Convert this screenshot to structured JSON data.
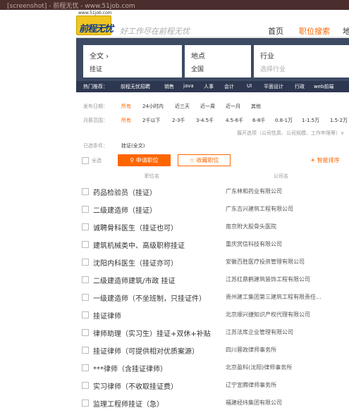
{
  "browser": {
    "tab_text": "[screenshot] - 前程无忧 - www.51job.com"
  },
  "header": {
    "logo_url": "www.51job.com",
    "logo_text": "前程无忧",
    "slogan": "好工作尽在前程无忧",
    "nav": [
      "首页",
      "职位搜索",
      "地"
    ]
  },
  "search": {
    "keyword_label": "全文 ›",
    "keyword_value": "挂证",
    "location_label": "地点",
    "location_value": "全国",
    "industry_label": "行业",
    "industry_placeholder": "选择行业"
  },
  "hot": {
    "label": "热门推荐：",
    "items": [
      "前程无忧招聘",
      "销售",
      "java",
      "人事",
      "会计",
      "UI",
      "平面设计",
      "行政",
      "web前端"
    ]
  },
  "filters": {
    "date_label": "发布日期：",
    "date_options": [
      "所有",
      "24小时内",
      "近三天",
      "近一周",
      "近一月",
      "其他"
    ],
    "salary_label": "月薪范围：",
    "salary_options": [
      "所有",
      "2千以下",
      "2-3千",
      "3-4.5千",
      "4.5-6千",
      "6-8千",
      "0.8-1万",
      "1-1.5万",
      "1.5-2万"
    ],
    "expand_text": "展开选项（公司性质、公司规模、工作年限等）∨"
  },
  "selected": {
    "label": "已选条件：",
    "value": "挂证(全文)"
  },
  "toolbar": {
    "select_all": "全选",
    "apply": "申请职位",
    "favorite": "收藏职位",
    "smart_sort": "智能排序"
  },
  "columns": {
    "job": "职位名",
    "company": "公司名"
  },
  "jobs": [
    {
      "title": "药品检验员（挂证）",
      "company": "广东林和药业有限公司"
    },
    {
      "title": "二级建造师（挂证）",
      "company": "广东吉兴建筑工程有限公司"
    },
    {
      "title": "诚聘骨科医生（挂证也可）",
      "company": "南京附大股骨头医院"
    },
    {
      "title": "建筑机械类中、高级职称挂证",
      "company": "重庆赏信科技有限公司"
    },
    {
      "title": "沈阳内科医生（挂证亦可）",
      "company": "安徽百胜医疗投资管理有限公司"
    },
    {
      "title": "二级建造师建筑/市政 挂证",
      "company": "江苏红鼎鹤建筑装饰工程有限公司"
    },
    {
      "title": "一级建造师（不坐班制，只挂证件）",
      "company": "贵州建工集团第三建筑工程有限责任..."
    },
    {
      "title": "挂证律师",
      "company": "北京顺兴捷知识产权代理有限公司"
    },
    {
      "title": "律师助理（实习生）挂证+双休+补贴",
      "company": "江苏法库企业管理有限公司"
    },
    {
      "title": "挂证律师（可提供相对优质案源）",
      "company": "四川蓉政律师事务所"
    },
    {
      "title": "***律师（含挂证律师）",
      "company": "北京盈科(沈阳)律师事务所"
    },
    {
      "title": "实习律师（不收取挂证费）",
      "company": "辽宁宣腾律师事务所"
    },
    {
      "title": "监理工程师挂证（急）",
      "company": "福建经纬集团有限公司"
    }
  ],
  "colors": {
    "accent": "#ff6600",
    "search_bg": "#3c4a63",
    "hot_bg": "#2d3750",
    "logo_bg": "#f2c521"
  }
}
